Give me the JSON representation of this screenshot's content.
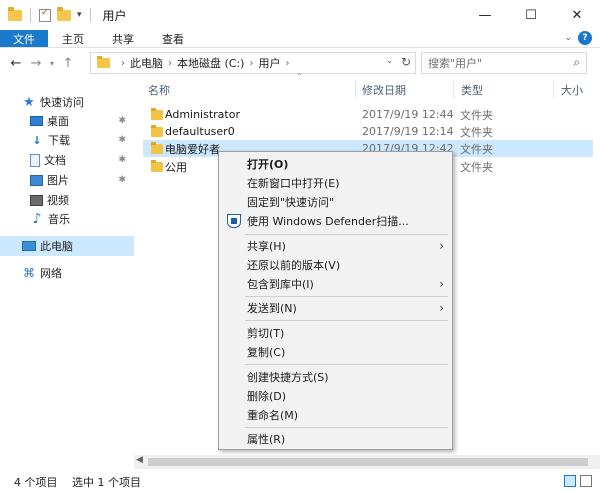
{
  "window": {
    "title": "用户",
    "controls": {
      "minimize": "—",
      "maximize": "☐",
      "close": "✕"
    }
  },
  "ribbon": {
    "tabs": [
      {
        "label": "文件"
      },
      {
        "label": "主页"
      },
      {
        "label": "共享"
      },
      {
        "label": "查看"
      }
    ],
    "help": "?"
  },
  "address": {
    "crumbs": [
      "此电脑",
      "本地磁盘 (C:)",
      "用户"
    ]
  },
  "search": {
    "placeholder": "搜索\"用户\""
  },
  "sidebar": {
    "items": [
      {
        "label": "快速访问",
        "icon": "star-icon"
      },
      {
        "label": "桌面",
        "icon": "desktop-icon",
        "pinned": true
      },
      {
        "label": "下载",
        "icon": "download-icon",
        "pinned": true
      },
      {
        "label": "文档",
        "icon": "document-icon",
        "pinned": true
      },
      {
        "label": "图片",
        "icon": "pictures-icon",
        "pinned": true
      },
      {
        "label": "视频",
        "icon": "videos-icon"
      },
      {
        "label": "音乐",
        "icon": "music-icon"
      },
      {
        "label": "此电脑",
        "icon": "computer-icon",
        "selected": true
      },
      {
        "label": "网络",
        "icon": "network-icon"
      }
    ]
  },
  "columns": {
    "name": "名称",
    "date": "修改日期",
    "type": "类型",
    "size": "大小"
  },
  "files": [
    {
      "name": "Administrator",
      "date": "2017/9/19 12:44",
      "type": "文件夹"
    },
    {
      "name": "defaultuser0",
      "date": "2017/9/19 12:14",
      "type": "文件夹"
    },
    {
      "name": "电脑爱好者",
      "date": "2017/9/19 12:42",
      "type": "文件夹",
      "selected": true
    },
    {
      "name": "公用",
      "date": "",
      "type": "文件夹"
    }
  ],
  "context_menu": {
    "items": [
      {
        "label": "打开(O)",
        "bold": true
      },
      {
        "label": "在新窗口中打开(E)"
      },
      {
        "label": "固定到\"快速访问\""
      },
      {
        "label": "使用 Windows Defender扫描...",
        "icon": "windows-defender-icon"
      },
      {
        "label": "共享(H)",
        "submenu": true
      },
      {
        "label": "还原以前的版本(V)"
      },
      {
        "label": "包含到库中(I)",
        "submenu": true
      },
      {
        "label": "发送到(N)",
        "submenu": true
      },
      {
        "label": "剪切(T)"
      },
      {
        "label": "复制(C)"
      },
      {
        "label": "创建快捷方式(S)"
      },
      {
        "label": "删除(D)"
      },
      {
        "label": "重命名(M)"
      },
      {
        "label": "属性(R)"
      }
    ]
  },
  "status": {
    "item_count": "4 个项目",
    "selected_count": "选中 1 个项目"
  }
}
